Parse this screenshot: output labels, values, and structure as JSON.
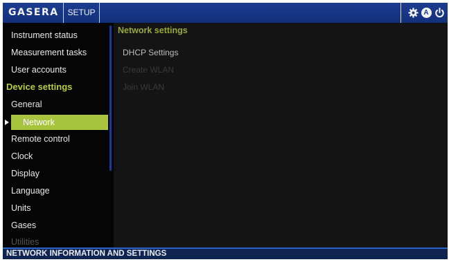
{
  "header": {
    "brand": "GASERA",
    "tab": "SETUP",
    "icons": [
      "gear-icon",
      "account-a-icon",
      "power-icon"
    ],
    "account_letter": "A"
  },
  "sidebar": {
    "items": [
      {
        "label": "Instrument status"
      },
      {
        "label": "Measurement tasks"
      },
      {
        "label": "User accounts"
      },
      {
        "label": "Device settings",
        "type": "section"
      },
      {
        "label": "General"
      },
      {
        "label": "Network",
        "selected": true
      },
      {
        "label": "Remote control"
      },
      {
        "label": "Clock"
      },
      {
        "label": "Display"
      },
      {
        "label": "Language"
      },
      {
        "label": "Units"
      },
      {
        "label": "Gases"
      },
      {
        "label": "Utilities",
        "dimmed": true
      }
    ]
  },
  "main": {
    "title": "Network settings",
    "options": [
      {
        "label": "DHCP Settings",
        "enabled": true
      },
      {
        "label": "Create WLAN",
        "enabled": false
      },
      {
        "label": "Join WLAN",
        "enabled": false
      }
    ]
  },
  "status": {
    "text": "NETWORK INFORMATION AND SETTINGS"
  },
  "colors": {
    "topbar": "#1b3b8e",
    "accent": "#a8c43e",
    "section": "#b7cf3e",
    "statusbar": "#0f2451"
  }
}
